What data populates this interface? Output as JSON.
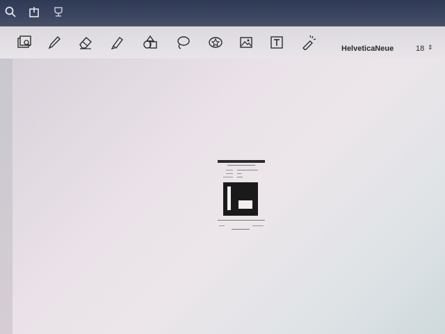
{
  "toolbar": {
    "tools": [
      {
        "name": "image-gallery-icon"
      },
      {
        "name": "pen-icon"
      },
      {
        "name": "eraser-icon"
      },
      {
        "name": "highlighter-icon"
      },
      {
        "name": "shapes-icon"
      },
      {
        "name": "lasso-icon"
      },
      {
        "name": "sticker-icon"
      },
      {
        "name": "image-icon"
      },
      {
        "name": "text-box-icon"
      },
      {
        "name": "laser-pointer-icon"
      }
    ],
    "font_name": "HelveticaNeue",
    "font_size": "18"
  },
  "colors": {
    "topbar": "#2f3a55",
    "toolbar_bg": "#e5e1e6",
    "icon_stroke": "#2b2b2b"
  }
}
